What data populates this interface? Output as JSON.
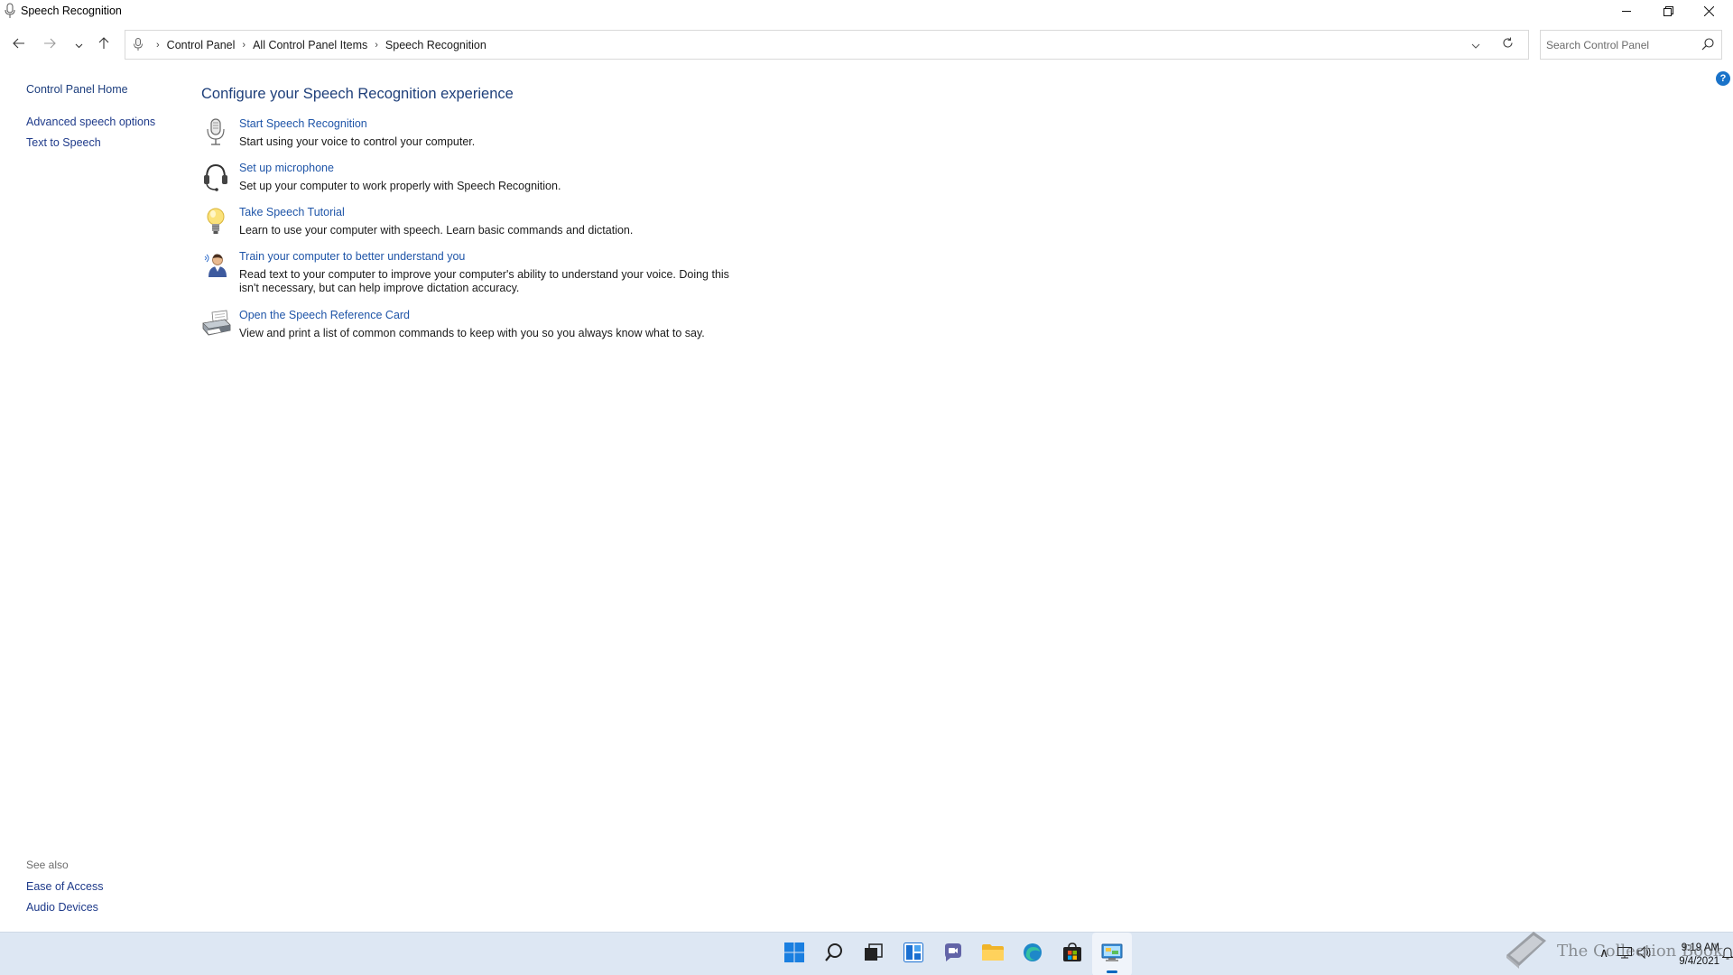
{
  "window": {
    "title": "Speech Recognition",
    "minimize_icon": "minimize-icon",
    "restore_icon": "restore-icon",
    "close_icon": "close-icon"
  },
  "navigation": {
    "breadcrumbs": [
      "Control Panel",
      "All Control Panel Items",
      "Speech Recognition"
    ],
    "search_placeholder": "Search Control Panel"
  },
  "left_pane": {
    "home": "Control Panel Home",
    "links": [
      "Advanced speech options",
      "Text to Speech"
    ]
  },
  "see_also": {
    "title": "See also",
    "links": [
      "Ease of Access",
      "Audio Devices"
    ]
  },
  "main": {
    "title": "Configure your Speech Recognition experience",
    "tasks": [
      {
        "icon": "microphone-icon",
        "link": "Start Speech Recognition",
        "description": "Start using your voice to control your computer."
      },
      {
        "icon": "headset-icon",
        "link": "Set up microphone",
        "description": "Set up your computer to work properly with Speech Recognition."
      },
      {
        "icon": "lightbulb-icon",
        "link": "Take Speech Tutorial",
        "description": "Learn to use your computer with speech.  Learn basic commands and dictation."
      },
      {
        "icon": "user-speaking-icon",
        "link": "Train your computer to better understand you",
        "description": "Read text to your computer to improve your computer's ability to understand your voice.  Doing this isn't necessary, but can help improve dictation accuracy."
      },
      {
        "icon": "printer-icon",
        "link": "Open the Speech Reference Card",
        "description": "View and print a list of common commands to keep with you so you always know what to say."
      }
    ]
  },
  "help_button": "?",
  "taskbar": {
    "apps": [
      "start-icon",
      "search-icon",
      "task-view-icon",
      "widgets-icon",
      "chat-icon",
      "file-explorer-icon",
      "edge-icon",
      "store-icon",
      "control-panel-icon"
    ],
    "active_app": "control-panel-icon",
    "time": "9:19 AM",
    "date": "9/4/2021"
  },
  "watermark": "The Collection Book",
  "colors": {
    "link": "#1f55a8",
    "title": "#1e3f7a",
    "taskbar": "#dde7f3",
    "accent": "#0067c0"
  }
}
